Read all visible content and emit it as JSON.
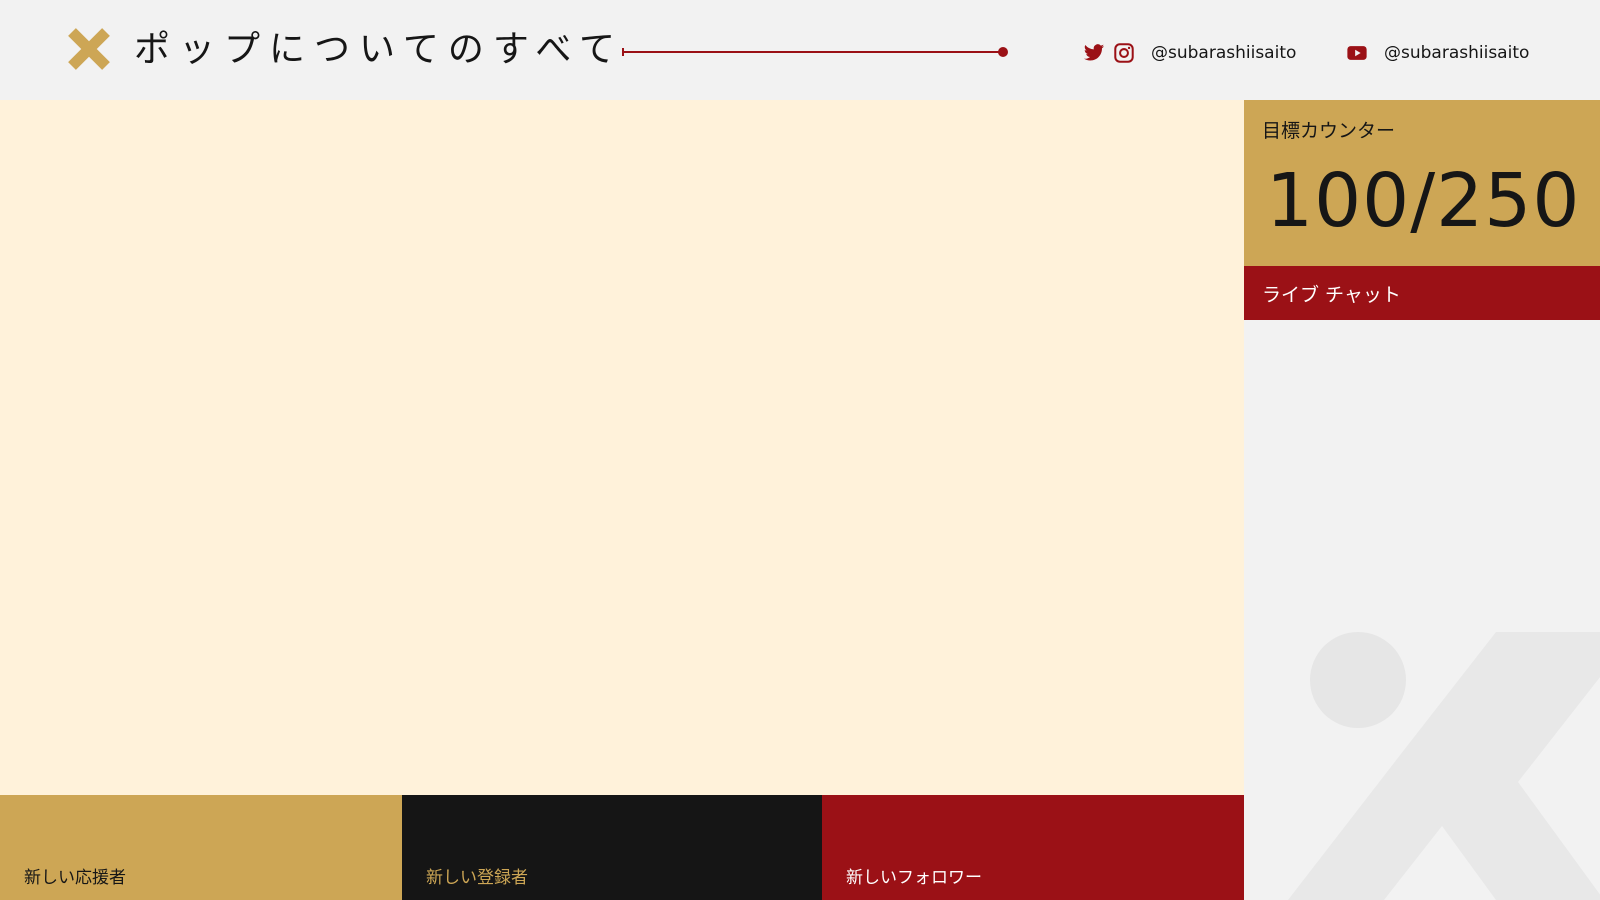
{
  "header": {
    "title": "ポップについてのすべて",
    "logo_icon": "x-mark-icon",
    "social": [
      {
        "icons": [
          "twitter-icon",
          "instagram-icon"
        ],
        "handle": "@subarashiisaito"
      },
      {
        "icons": [
          "youtube-icon"
        ],
        "handle": "@subarashiisaito"
      }
    ]
  },
  "sidebar": {
    "goal": {
      "label": "目標カウンター",
      "count": "100/250"
    },
    "chat": {
      "label": "ライブ チャット"
    }
  },
  "alerts": {
    "supporter": "新しい応援者",
    "subscriber": "新しい登録者",
    "follower": "新しいフォロワー"
  },
  "colors": {
    "gold": "#cda655",
    "red": "#9b1116",
    "black": "#151515",
    "cream": "#fff2da",
    "light_gray": "#f2f2f2"
  }
}
